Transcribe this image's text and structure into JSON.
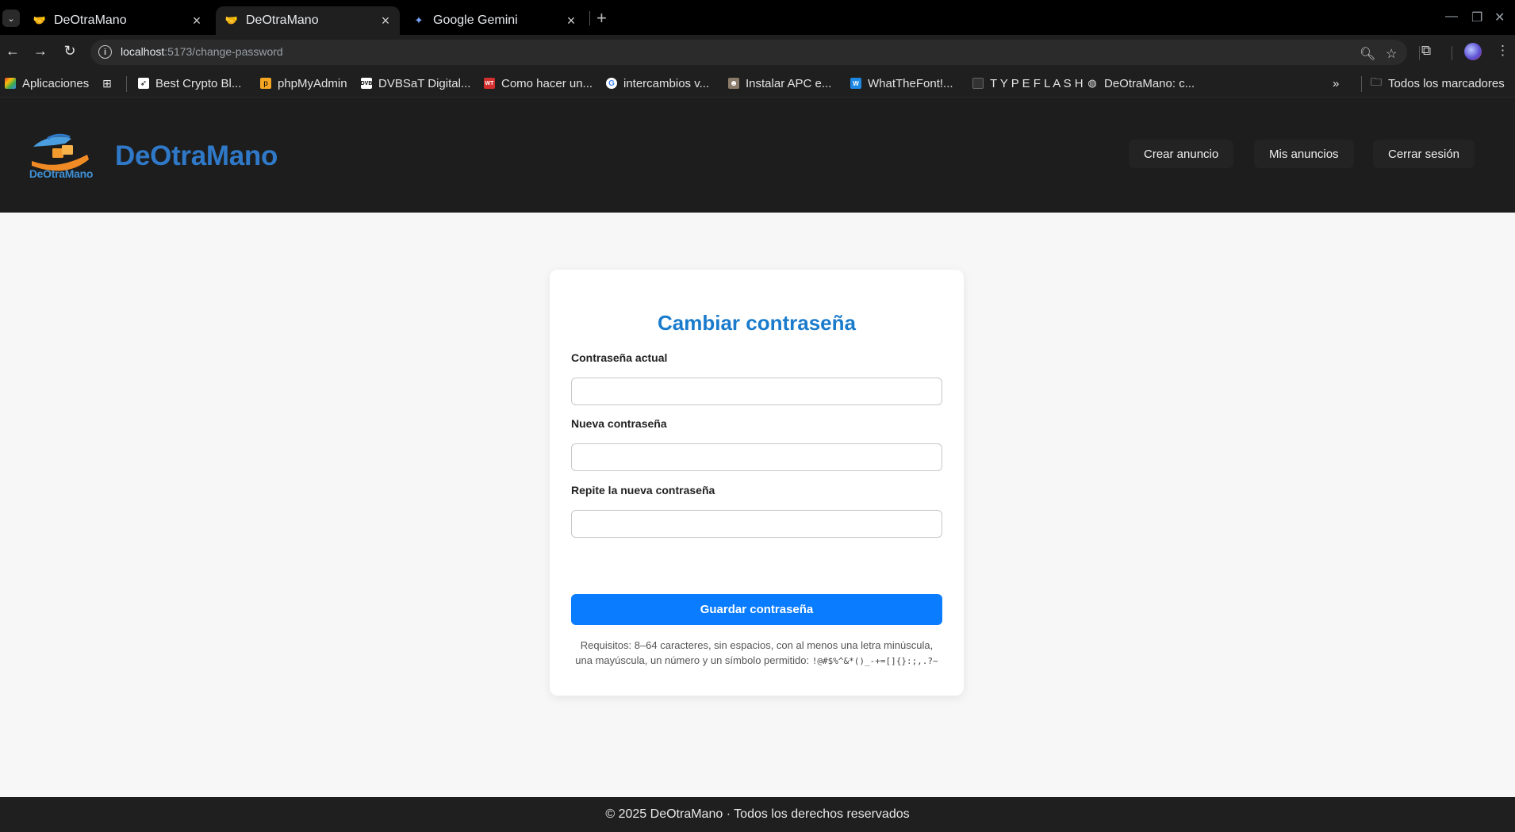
{
  "browser": {
    "tabs": [
      {
        "title": "DeOtraMano",
        "active": false
      },
      {
        "title": "DeOtraMano",
        "active": true
      },
      {
        "title": "Google Gemini",
        "active": false
      }
    ],
    "url_host": "localhost",
    "url_path": ":5173/change-password",
    "bookmarks": [
      {
        "label": "Aplicaciones",
        "icon": "apps-grid-icon"
      },
      {
        "label": "Best Crypto Bl...",
        "icon": "rocket-icon"
      },
      {
        "label": "phpMyAdmin",
        "icon": "phpmyadmin-icon"
      },
      {
        "label": "DVBSaT Digital...",
        "icon": "dvb-icon"
      },
      {
        "label": "Como hacer un...",
        "icon": "wt-icon"
      },
      {
        "label": "intercambios v...",
        "icon": "google-icon"
      },
      {
        "label": "Instalar APC e...",
        "icon": "person-icon"
      },
      {
        "label": "WhatTheFont!...",
        "icon": "wtf-icon"
      },
      {
        "label": "T Y P E F L A S H",
        "icon": "typeflash-icon"
      },
      {
        "label": "DeOtraMano: c...",
        "icon": "globe-icon"
      }
    ],
    "all_bookmarks": "Todos los marcadores"
  },
  "header": {
    "logo_text": "DeOtraMano",
    "brand": "DeOtraMano",
    "nav": {
      "create": "Crear anuncio",
      "mine": "Mis anuncios",
      "logout": "Cerrar sesión"
    }
  },
  "form": {
    "title": "Cambiar contraseña",
    "current_label": "Contraseña actual",
    "new_label": "Nueva contraseña",
    "repeat_label": "Repite la nueva contraseña",
    "current_value": "",
    "new_value": "",
    "repeat_value": "",
    "submit": "Guardar contraseña",
    "requirements": "Requisitos: 8–64 caracteres, sin espacios, con al menos una letra minúscula, una mayúscula, un número y un símbolo permitido: ",
    "allowed_symbols": "!@#$%^&*()_-+=[]{}:;,.?~"
  },
  "footer": {
    "text": "© 2025 DeOtraMano · Todos los derechos reservados"
  },
  "colors": {
    "brand_blue": "#2f79c8",
    "title_blue": "#1a7bcc",
    "button_blue": "#0a7cff",
    "header_bg": "#1d1d1d"
  }
}
